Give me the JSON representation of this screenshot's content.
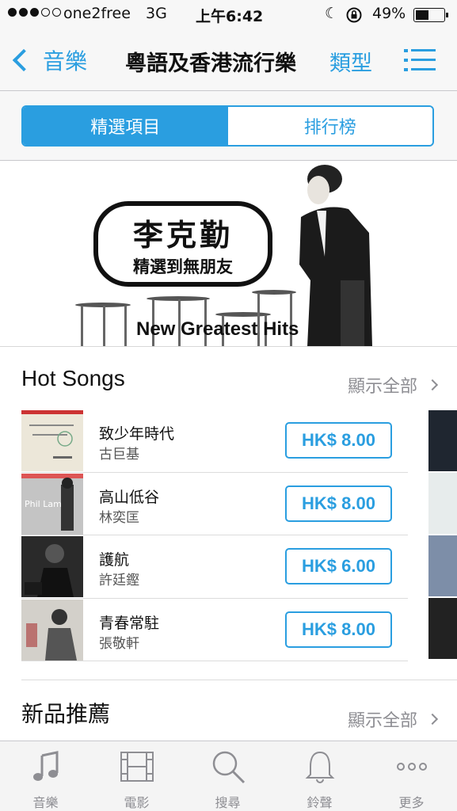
{
  "status_bar": {
    "carrier": "one2free",
    "network": "3G",
    "time": "上午6:42",
    "battery_percent": "49%",
    "battery_level": 0.49
  },
  "nav": {
    "back_label": "音樂",
    "title": "粵語及香港流行樂",
    "genre_label": "類型"
  },
  "segments": [
    {
      "label": "精選項目",
      "active": true
    },
    {
      "label": "排行榜",
      "active": false
    }
  ],
  "banner": {
    "artist": "李克勤",
    "album_cn": "精選到無朋友",
    "album_en": "New Greatest Hits"
  },
  "hot_songs": {
    "title": "Hot Songs",
    "show_all": "顯示全部",
    "items": [
      {
        "title": "致少年時代",
        "artist": "古巨基",
        "price": "HK$ 8.00",
        "art_color": "#e9e4d6"
      },
      {
        "title": "高山低谷",
        "artist": "林奕匡",
        "price": "HK$ 8.00",
        "art_color": "#bdbdbd"
      },
      {
        "title": "護航",
        "artist": "許廷鏗",
        "price": "HK$ 6.00",
        "art_color": "#2b2b2b"
      },
      {
        "title": "青春常駐",
        "artist": "張敬軒",
        "price": "HK$ 8.00",
        "art_color": "#c9c6c0"
      }
    ]
  },
  "new_releases": {
    "title": "新品推薦",
    "show_all": "顯示全部"
  },
  "tabs": [
    {
      "label": "音樂",
      "icon": "music-note-icon"
    },
    {
      "label": "電影",
      "icon": "film-icon"
    },
    {
      "label": "搜尋",
      "icon": "search-icon"
    },
    {
      "label": "鈴聲",
      "icon": "bell-icon"
    },
    {
      "label": "更多",
      "icon": "more-icon"
    }
  ],
  "colors": {
    "accent": "#2a9ee0",
    "tab_inactive": "#8e8e93"
  }
}
